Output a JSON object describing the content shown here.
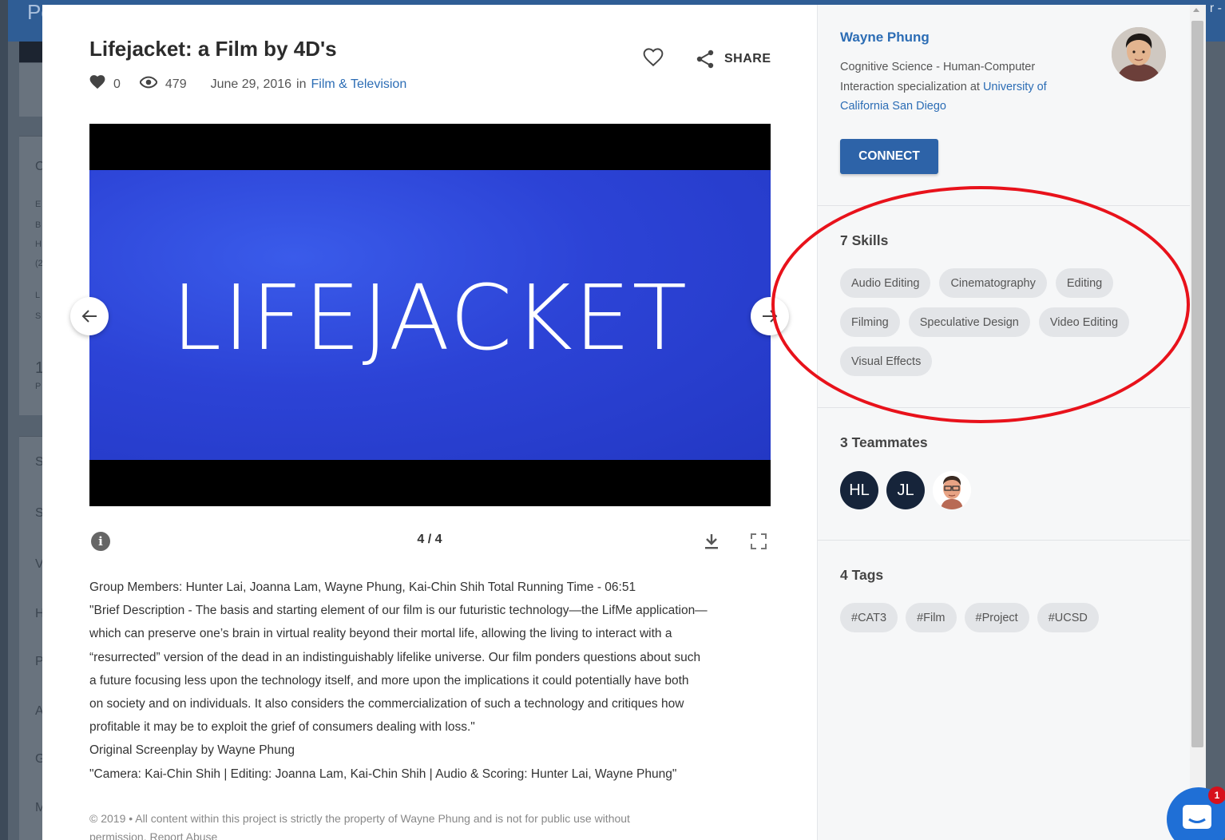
{
  "background": {
    "header_logo_fragment": "Po",
    "header_right_fragment": "r -",
    "side_letters": [
      "C",
      "E",
      "B",
      "H",
      "(2",
      "L",
      "S",
      "1",
      "P",
      "S",
      "S",
      "V",
      "H",
      "P",
      "A",
      "G",
      "M"
    ]
  },
  "project": {
    "title": "Lifejacket: a Film by 4D's",
    "likes": "0",
    "views": "479",
    "date": "June 29, 2016",
    "in_label": "in",
    "category": "Film & Television",
    "share_label": "SHARE"
  },
  "media": {
    "slide_title": "LIFEJACKET",
    "counter": "4 / 4"
  },
  "description": [
    "Group Members: Hunter Lai, Joanna Lam, Wayne Phung, Kai-Chin Shih Total Running Time - 06:51",
    "\"Brief Description - The basis and starting element of our film is our futuristic technology—the LifMe application—",
    "which can preserve one’s brain in virtual reality beyond their mortal life, allowing the living to interact with a",
    "“resurrected” version of the dead in an indistinguishably lifelike universe. Our film ponders questions about such",
    "a future focusing less upon the technology itself, and more upon the implications it could potentially have both",
    "on society and on individuals. It also considers the commercialization of such a technology and critiques how",
    "profitable it may be to exploit the grief of consumers dealing with loss.\"",
    "Original Screenplay by Wayne Phung",
    "\"Camera: Kai-Chin Shih | Editing: Joanna Lam, Kai-Chin Shih | Audio & Scoring: Hunter Lai, Wayne Phung\""
  ],
  "footer": {
    "line1": "© 2019 • All content within this project is strictly the property of Wayne Phung and is not for public use without",
    "line2": "permission. Report Abuse"
  },
  "author": {
    "name": "Wayne Phung",
    "bio_prefix": "Cognitive Science - Human-Computer Interaction specialization at ",
    "school": "University of California San Diego",
    "connect_label": "CONNECT"
  },
  "skills": {
    "title": "7 Skills",
    "items": [
      "Audio Editing",
      "Cinematography",
      "Editing",
      "Filming",
      "Speculative Design",
      "Video Editing",
      "Visual Effects"
    ]
  },
  "teammates": {
    "title": "3 Teammates",
    "initials": [
      "HL",
      "JL"
    ]
  },
  "tags": {
    "title": "4 Tags",
    "items": [
      "#CAT3",
      "#Film",
      "#Project",
      "#UCSD"
    ]
  },
  "chat": {
    "badge": "1"
  },
  "colors": {
    "link": "#2c6db5",
    "connect": "#2d63a8",
    "annotation": "#e8121b",
    "video_blue": "#2c43d6"
  }
}
